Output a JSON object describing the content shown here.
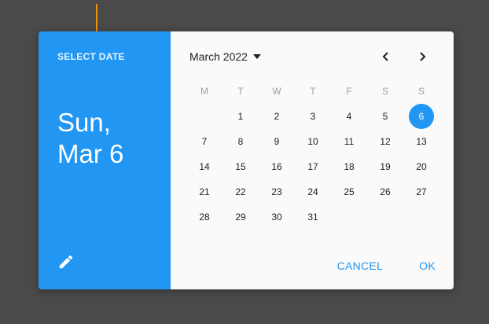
{
  "header": {
    "select_label": "SELECT DATE",
    "day_line": "Sun,",
    "date_line": "Mar 6",
    "edit_icon": "pencil-icon"
  },
  "calendar": {
    "month_label": "March 2022",
    "weekdays": [
      "M",
      "T",
      "W",
      "T",
      "F",
      "S",
      "S"
    ],
    "weeks": [
      [
        "",
        "1",
        "2",
        "3",
        "4",
        "5",
        "6"
      ],
      [
        "7",
        "8",
        "9",
        "10",
        "11",
        "12",
        "13"
      ],
      [
        "14",
        "15",
        "16",
        "17",
        "18",
        "19",
        "20"
      ],
      [
        "21",
        "22",
        "23",
        "24",
        "25",
        "26",
        "27"
      ],
      [
        "28",
        "29",
        "30",
        "31",
        "",
        "",
        ""
      ]
    ],
    "selected_day": "6"
  },
  "actions": {
    "cancel_label": "CANCEL",
    "ok_label": "OK"
  },
  "colors": {
    "accent": "#2196f3",
    "backdrop": "#4a4a4a",
    "annotation_arrow": "#f0900c"
  }
}
